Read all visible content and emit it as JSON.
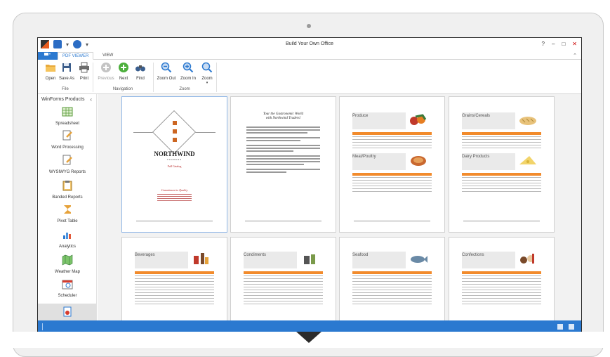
{
  "window": {
    "title": "Build Your Own Office"
  },
  "tabs": {
    "file": "",
    "active": "PDF VIEWER",
    "view": "VIEW"
  },
  "ribbon": {
    "buttons": {
      "open": "Open",
      "save_as": "Save As",
      "print": "Print",
      "previous": "Previous",
      "next": "Next",
      "find": "Find",
      "zoom_out": "Zoom Out",
      "zoom_in": "Zoom In",
      "zoom": "Zoom"
    },
    "groups": {
      "file": "File",
      "navigation": "Navigation",
      "zoom": "Zoom"
    }
  },
  "sidebar": {
    "header": "WinForms Products",
    "items": [
      {
        "label": "Spreadsheet"
      },
      {
        "label": "Word Processing"
      },
      {
        "label": "WYSIWYG Reports"
      },
      {
        "label": "Banded Reports"
      },
      {
        "label": "Pivot Table"
      },
      {
        "label": "Analytics"
      },
      {
        "label": "Weather Map"
      },
      {
        "label": "Scheduler"
      }
    ]
  },
  "pages": {
    "cover": {
      "brand": "NORTHWIND",
      "sub": "TRADERS",
      "red1": "Fall Catalog",
      "red2": "Commitment to Quality"
    },
    "letter": {
      "title_line1": "Tour the Gastronomic World",
      "title_line2": "with Northwind Traders!"
    },
    "categories": [
      "Produce",
      "Meat/Poultry",
      "Grains/Cereals",
      "Dairy Products",
      "Beverages",
      "Condiments",
      "Seafood",
      "Confections"
    ]
  },
  "colors": {
    "accent": "#2b79d0",
    "table_header": "#f28b2c"
  }
}
